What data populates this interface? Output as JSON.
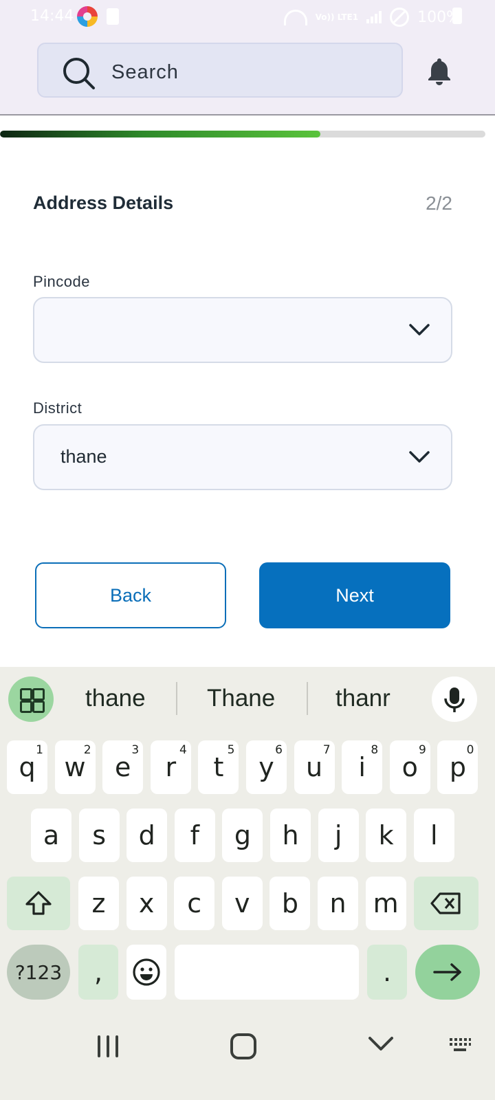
{
  "status_bar": {
    "time": "14:44",
    "battery": "100%",
    "network": "Vo)) LTE1"
  },
  "header": {
    "search_placeholder": "Search"
  },
  "progress": {
    "value": 0.66
  },
  "form": {
    "title": "Address Details",
    "step": "2/2",
    "pincode": {
      "label": "Pincode",
      "value": ""
    },
    "district": {
      "label": "District",
      "value": "thane"
    }
  },
  "buttons": {
    "back": "Back",
    "next": "Next"
  },
  "keyboard": {
    "suggestions": [
      "thane",
      "Thane",
      "thanr"
    ],
    "row1": [
      {
        "key": "q",
        "hint": "1"
      },
      {
        "key": "w",
        "hint": "2"
      },
      {
        "key": "e",
        "hint": "3"
      },
      {
        "key": "r",
        "hint": "4"
      },
      {
        "key": "t",
        "hint": "5"
      },
      {
        "key": "y",
        "hint": "6"
      },
      {
        "key": "u",
        "hint": "7"
      },
      {
        "key": "i",
        "hint": "8"
      },
      {
        "key": "o",
        "hint": "9"
      },
      {
        "key": "p",
        "hint": "0"
      }
    ],
    "row2": [
      "a",
      "s",
      "d",
      "f",
      "g",
      "h",
      "j",
      "k",
      "l"
    ],
    "row3": [
      "z",
      "x",
      "c",
      "v",
      "b",
      "n",
      "m"
    ],
    "symbols": "?123",
    "comma": ",",
    "period": "."
  },
  "colors": {
    "primary": "#0670be",
    "progress_end": "#5ac33c"
  }
}
